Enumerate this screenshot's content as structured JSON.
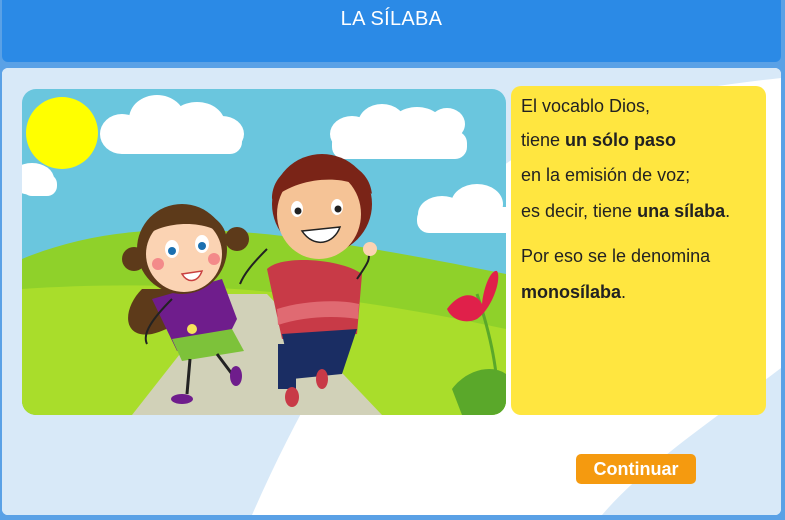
{
  "header": {
    "title": "LA SÍLABA"
  },
  "card": {
    "line1": "El vocablo Dios,",
    "line2_prefix": "tiene ",
    "line2_bold": "un sólo paso",
    "line3": "en la emisión de voz;",
    "line4_prefix": "es decir, tiene ",
    "line4_bold": "una sílaba",
    "line4_suffix": ".",
    "line5": "Por eso se le denomina",
    "line6_bold": "monosílaba",
    "line6_suffix": "."
  },
  "actions": {
    "continue_label": "Continuar"
  },
  "colors": {
    "header": "#2b8ae6",
    "card": "#ffe640",
    "button": "#f59a0f",
    "background": "#5aa1e6"
  }
}
